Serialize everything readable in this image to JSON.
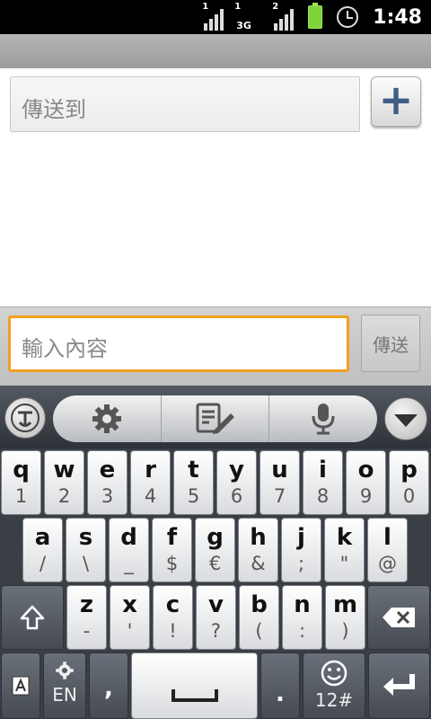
{
  "status_bar": {
    "time": "1:48",
    "signal1_label": "1",
    "signal2_label": "1",
    "signal2_net": "3G",
    "signal3_label": "2",
    "icons": [
      "signal-icon",
      "3g-signal-icon",
      "signal-icon",
      "battery-icon",
      "alarm-icon"
    ]
  },
  "recipient": {
    "placeholder": "傳送到",
    "add_label": "+"
  },
  "compose": {
    "placeholder": "輸入內容",
    "send_label": "傳送"
  },
  "keyboard": {
    "row1": [
      {
        "main": "q",
        "sub": "1"
      },
      {
        "main": "w",
        "sub": "2"
      },
      {
        "main": "e",
        "sub": "3"
      },
      {
        "main": "r",
        "sub": "4"
      },
      {
        "main": "t",
        "sub": "5"
      },
      {
        "main": "y",
        "sub": "6"
      },
      {
        "main": "u",
        "sub": "7"
      },
      {
        "main": "i",
        "sub": "8"
      },
      {
        "main": "o",
        "sub": "9"
      },
      {
        "main": "p",
        "sub": "0"
      }
    ],
    "row2": [
      {
        "main": "a",
        "sub": "/"
      },
      {
        "main": "s",
        "sub": "\\"
      },
      {
        "main": "d",
        "sub": "_"
      },
      {
        "main": "f",
        "sub": "$"
      },
      {
        "main": "g",
        "sub": "€"
      },
      {
        "main": "h",
        "sub": "&"
      },
      {
        "main": "j",
        "sub": ";"
      },
      {
        "main": "k",
        "sub": "\""
      },
      {
        "main": "l",
        "sub": "@"
      }
    ],
    "row3": [
      {
        "main": "z",
        "sub": "-"
      },
      {
        "main": "x",
        "sub": "'"
      },
      {
        "main": "c",
        "sub": "!"
      },
      {
        "main": "v",
        "sub": "?"
      },
      {
        "main": "b",
        "sub": "("
      },
      {
        "main": "n",
        "sub": ":"
      },
      {
        "main": "m",
        "sub": ")"
      }
    ],
    "lang_label": "EN",
    "comma_label": ",",
    "period_label": ".",
    "symbols_label": "12#"
  }
}
